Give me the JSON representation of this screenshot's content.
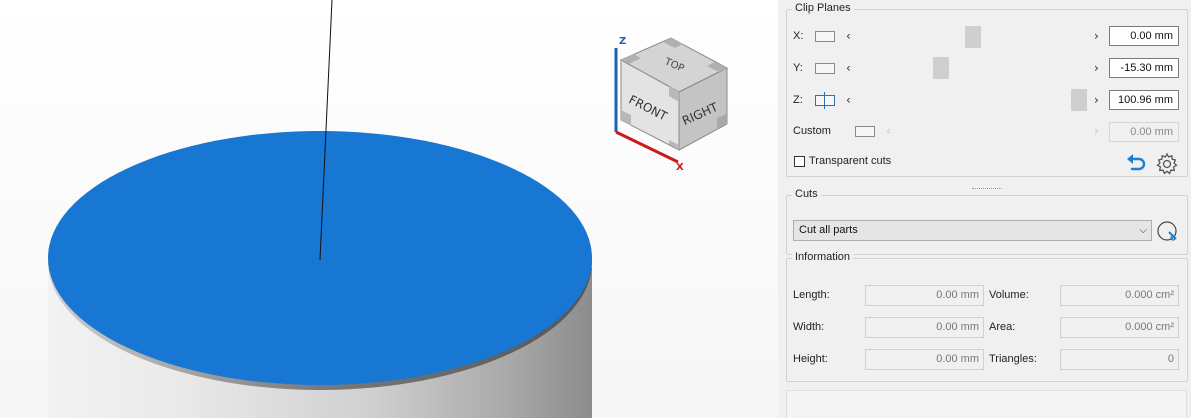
{
  "viewcube": {
    "faces": {
      "top": "TOP",
      "front": "FRONT",
      "right": "RIGHT"
    },
    "axes": {
      "x": "X",
      "z": "Z"
    }
  },
  "clip_planes": {
    "title": "Clip Planes",
    "rows": [
      {
        "label": "X:",
        "value": "0.00 mm",
        "slider_fraction": 0.5
      },
      {
        "label": "Y:",
        "value": "-15.30 mm",
        "slider_fraction": 0.37
      },
      {
        "label": "Z:",
        "value": "100.96 mm",
        "slider_fraction": 0.96
      }
    ],
    "custom": {
      "label": "Custom",
      "value": "0.00 mm",
      "enabled": false
    },
    "transparent_cuts": {
      "label": "Transparent cuts",
      "checked": false
    }
  },
  "cuts": {
    "title": "Cuts",
    "selected": "Cut all parts"
  },
  "information": {
    "title": "Information",
    "length": {
      "label": "Length:",
      "value": "0.00 mm"
    },
    "width": {
      "label": "Width:",
      "value": "0.00 mm"
    },
    "height": {
      "label": "Height:",
      "value": "0.00 mm"
    },
    "volume": {
      "label": "Volume:",
      "value": "0.000 cm²"
    },
    "area": {
      "label": "Area:",
      "value": "0.000 cm²"
    },
    "triangles": {
      "label": "Triangles:",
      "value": "0"
    }
  },
  "colors": {
    "cut_face": "#1877d2",
    "axis_x": "#cc1a1a",
    "axis_z": "#1a64b4",
    "accent": "#1c7fd4"
  }
}
